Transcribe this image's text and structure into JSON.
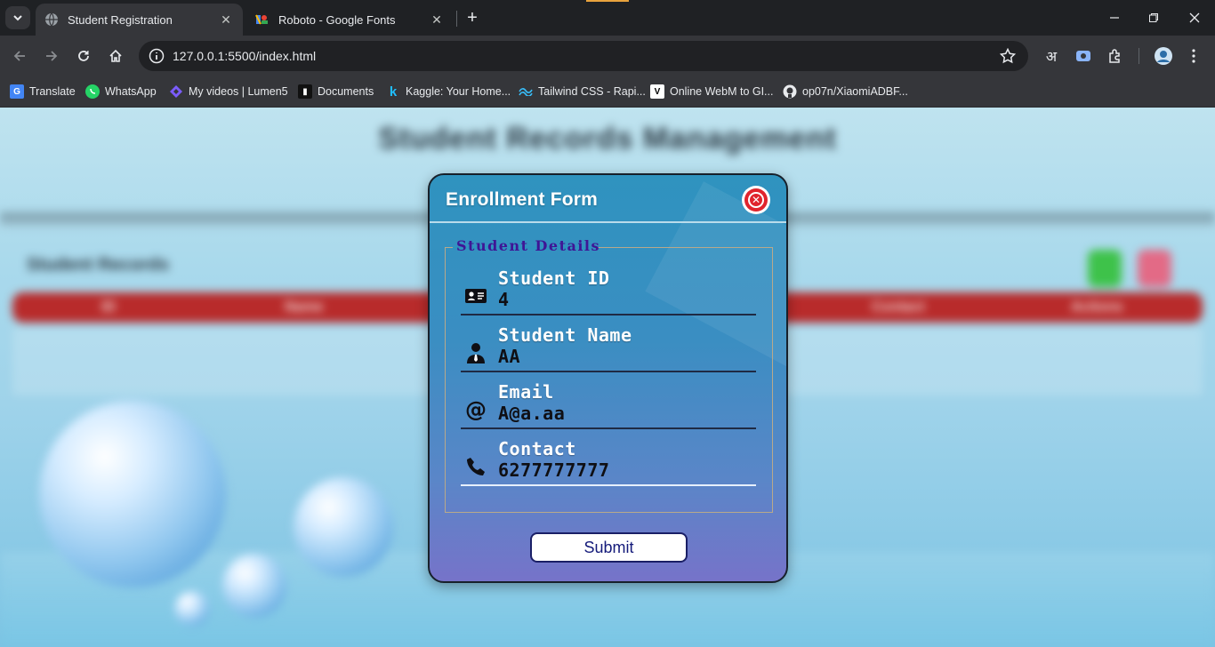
{
  "browser": {
    "tabs": [
      {
        "title": "Student Registration",
        "active": true
      },
      {
        "title": "Roboto - Google Fonts",
        "active": false
      }
    ],
    "url": "127.0.0.1:5500/index.html",
    "language_glyph": "अ",
    "bookmarks": [
      {
        "label": "Translate",
        "icon": "translate-icon"
      },
      {
        "label": "WhatsApp",
        "icon": "whatsapp-icon"
      },
      {
        "label": "My videos | Lumen5",
        "icon": "lumen5-icon"
      },
      {
        "label": "Documents",
        "icon": "documents-icon"
      },
      {
        "label": "Kaggle: Your Home...",
        "icon": "kaggle-icon"
      },
      {
        "label": "Tailwind CSS - Rapi...",
        "icon": "tailwind-icon"
      },
      {
        "label": "Online WebM to GI...",
        "icon": "webm-icon"
      },
      {
        "label": "op07n/XiaomiADBF...",
        "icon": "github-icon"
      }
    ]
  },
  "page": {
    "title": "Student Records Management",
    "records_heading": "Student Records",
    "table_headers": [
      "ID",
      "Name",
      "Contact",
      "Actions"
    ]
  },
  "modal": {
    "title": "Enrollment Form",
    "legend": "Student Details",
    "fields": [
      {
        "label": "Student ID",
        "value": "4",
        "icon": "id-card-icon"
      },
      {
        "label": "Student Name",
        "value": "AA",
        "icon": "user-tie-icon"
      },
      {
        "label": "Email",
        "value": "A@a.aa",
        "icon": "at-icon"
      },
      {
        "label": "Contact",
        "value": "6277777777",
        "icon": "phone-icon"
      }
    ],
    "submit_label": "Submit"
  },
  "colors": {
    "close_red": "#e0242d",
    "legend_purple": "#3f1595",
    "table_head_red": "#b82b2b",
    "add_green": "#3ec24a",
    "delete_pink": "#e36a86"
  }
}
